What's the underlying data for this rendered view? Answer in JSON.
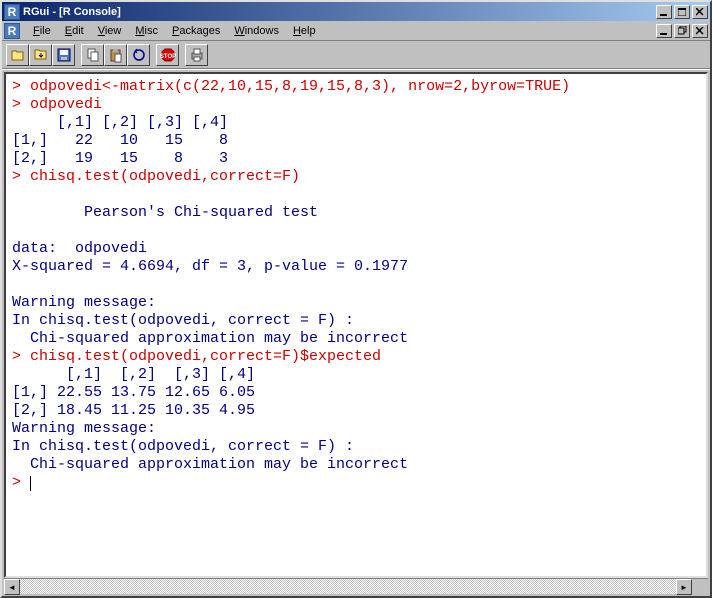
{
  "window": {
    "title": "RGui - [R Console]",
    "icon_letter": "R"
  },
  "menu": {
    "file": "File",
    "edit": "Edit",
    "view": "View",
    "misc": "Misc",
    "packages": "Packages",
    "windows": "Windows",
    "help": "Help"
  },
  "console_lines": [
    {
      "cls": "r-in",
      "t": "> odpovedi<-matrix(c(22,10,15,8,19,15,8,3), nrow=2,byrow=TRUE)"
    },
    {
      "cls": "r-in",
      "t": "> odpovedi"
    },
    {
      "cls": "r-out",
      "t": "     [,1] [,2] [,3] [,4]"
    },
    {
      "cls": "r-out",
      "t": "[1,]   22   10   15    8"
    },
    {
      "cls": "r-out",
      "t": "[2,]   19   15    8    3"
    },
    {
      "cls": "r-in",
      "t": "> chisq.test(odpovedi,correct=F)"
    },
    {
      "cls": "r-out",
      "t": ""
    },
    {
      "cls": "r-out",
      "t": "        Pearson's Chi-squared test"
    },
    {
      "cls": "r-out",
      "t": ""
    },
    {
      "cls": "r-out",
      "t": "data:  odpovedi"
    },
    {
      "cls": "r-out",
      "t": "X-squared = 4.6694, df = 3, p-value = 0.1977"
    },
    {
      "cls": "r-out",
      "t": ""
    },
    {
      "cls": "r-out",
      "t": "Warning message:"
    },
    {
      "cls": "r-out",
      "t": "In chisq.test(odpovedi, correct = F) :"
    },
    {
      "cls": "r-out",
      "t": "  Chi-squared approximation may be incorrect"
    },
    {
      "cls": "r-in",
      "t": "> chisq.test(odpovedi,correct=F)$expected"
    },
    {
      "cls": "r-out",
      "t": "      [,1]  [,2]  [,3] [,4]"
    },
    {
      "cls": "r-out",
      "t": "[1,] 22.55 13.75 12.65 6.05"
    },
    {
      "cls": "r-out",
      "t": "[2,] 18.45 11.25 10.35 4.95"
    },
    {
      "cls": "r-out",
      "t": "Warning message:"
    },
    {
      "cls": "r-out",
      "t": "In chisq.test(odpovedi, correct = F) :"
    },
    {
      "cls": "r-out",
      "t": "  Chi-squared approximation may be incorrect"
    }
  ],
  "prompt": "> "
}
